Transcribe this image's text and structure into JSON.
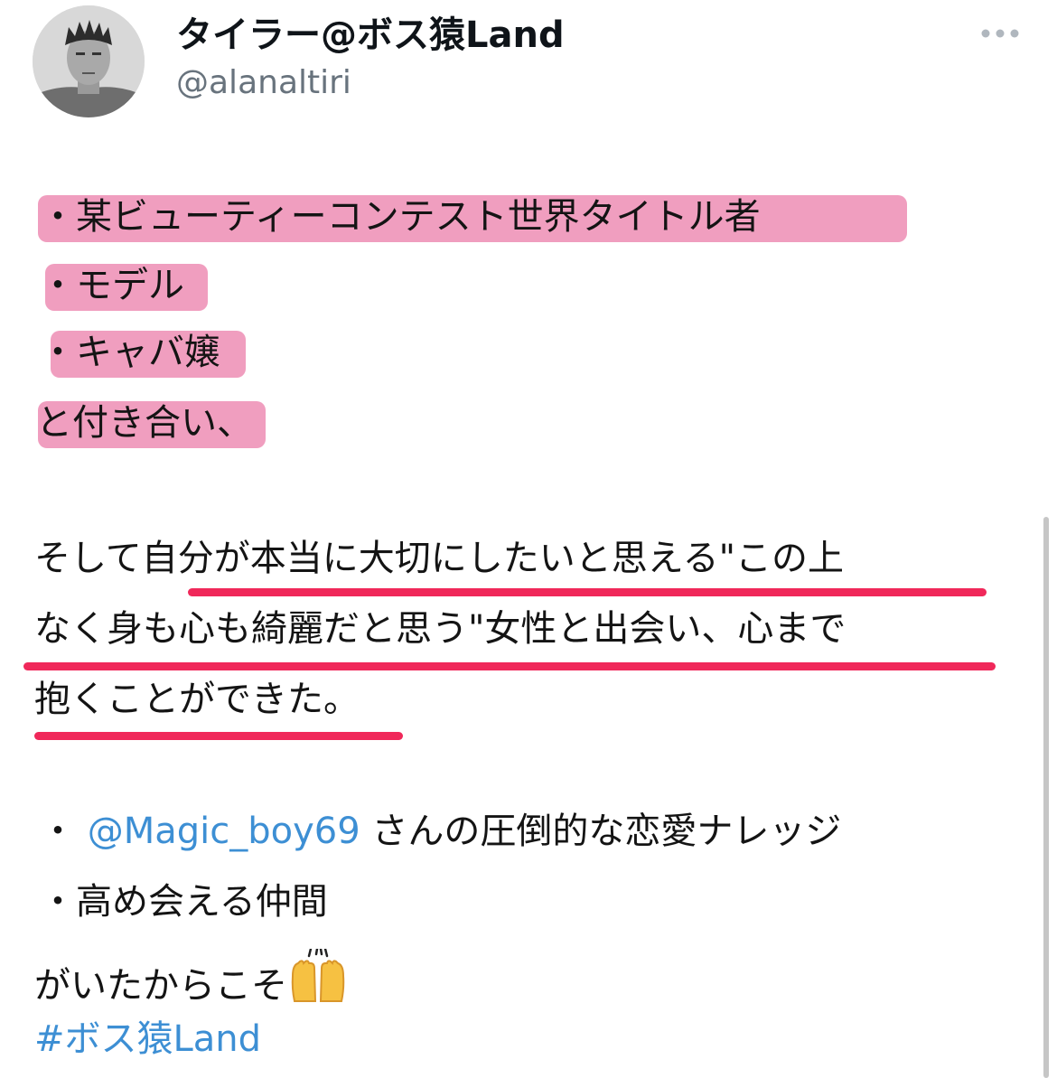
{
  "header": {
    "display_name": "タイラー@ボス猿Land",
    "handle": "@alanaltiri",
    "avatar_icon": "user-avatar-photo",
    "more_icon": "more-horizontal-icon"
  },
  "tweet": {
    "highlighted": [
      "・某ビューティーコンテスト世界タイトル者",
      "・モデル",
      "・キャバ嬢",
      "と付き合い、"
    ],
    "underlined": [
      "そして自分が本当に大切にしたいと思える\"この上",
      "なく身も心も綺麗だと思う\"女性と出会い、心まで",
      "抱くことができた。"
    ],
    "line_mention": {
      "prefix": "・ ",
      "mention": "@Magic_boy69",
      "suffix": " さんの圧倒的な恋愛ナレッジ"
    },
    "line_peers": "・高め会える仲間",
    "line_because": "がいたからこそ",
    "emoji": "raising-hands-emoji",
    "hashtag": "#ボス猿Land"
  },
  "colors": {
    "highlight_pink": "#ee94b8",
    "underline_red": "#f0285a",
    "link_blue": "#3d8fd4",
    "handle_gray": "#68737d"
  }
}
